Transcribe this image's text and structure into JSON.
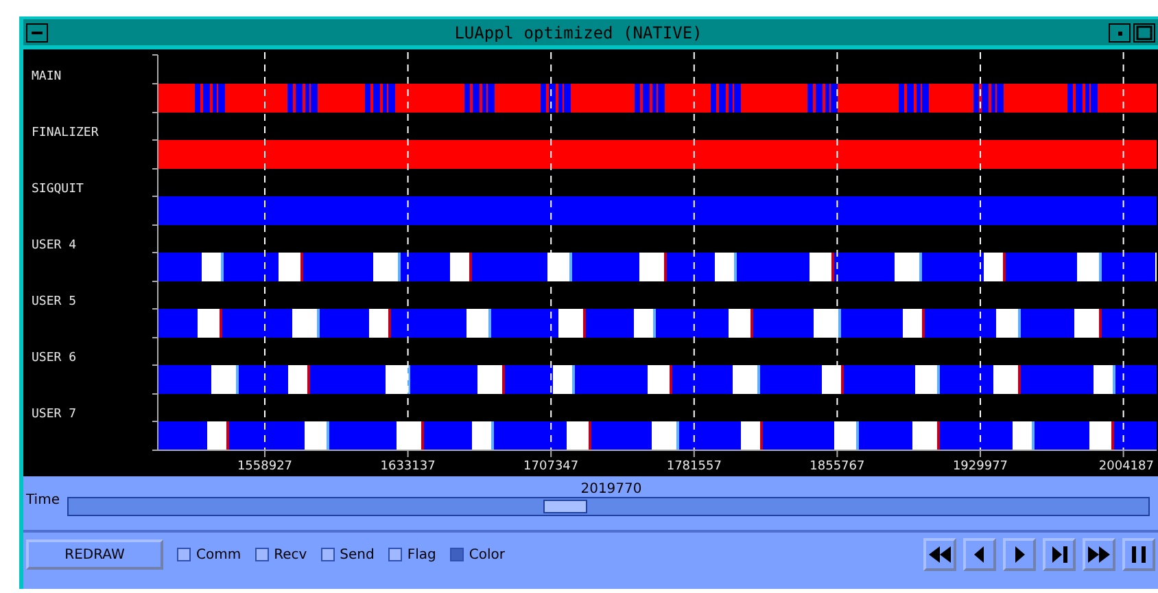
{
  "window": {
    "title": "LUAppl optimized (NATIVE)"
  },
  "threads": [
    {
      "label": "MAIN",
      "kind": "mixed"
    },
    {
      "label": "FINALIZER",
      "kind": "busy"
    },
    {
      "label": "SIGQUIT",
      "kind": "idle"
    },
    {
      "label": "USER 4",
      "kind": "periodic"
    },
    {
      "label": "USER 5",
      "kind": "periodic"
    },
    {
      "label": "USER 6",
      "kind": "periodic"
    },
    {
      "label": "USER 7",
      "kind": "periodic"
    }
  ],
  "time_ticks": [
    "1558927",
    "1633137",
    "1707347",
    "1781557",
    "1855767",
    "1929977",
    "2004187"
  ],
  "time_slider": {
    "label": "Time",
    "value": "2019770",
    "level": 0.46
  },
  "redraw_button": "REDRAW",
  "options": [
    {
      "label": "Comm",
      "checked": false
    },
    {
      "label": "Recv",
      "checked": false
    },
    {
      "label": "Send",
      "checked": false
    },
    {
      "label": "Flag",
      "checked": false
    },
    {
      "label": "Color",
      "checked": true
    }
  ],
  "playback_buttons": [
    {
      "kind": "rewind"
    },
    {
      "kind": "step-back"
    },
    {
      "kind": "play"
    },
    {
      "kind": "step-end"
    },
    {
      "kind": "fast-forward"
    },
    {
      "kind": "pause"
    }
  ]
}
